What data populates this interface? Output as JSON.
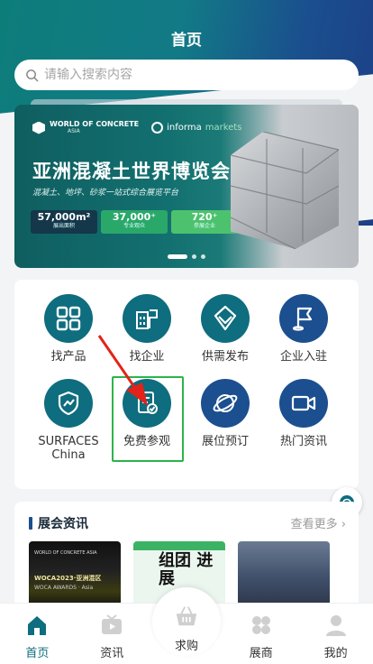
{
  "header": {
    "title": "首页"
  },
  "search": {
    "placeholder": "请输入搜索内容"
  },
  "banner": {
    "logo_woc": "WORLD OF CONCRETE",
    "logo_woc_sub": "ASIA",
    "logo_informa": "informa",
    "logo_informa_m": "markets",
    "title": "亚洲混凝土世界博览会",
    "subtitle": "混凝土、地坪、砂浆一站式综合展览平台",
    "stats": [
      {
        "value": "57,000m²",
        "label": "展出面积"
      },
      {
        "value": "37,000⁺",
        "label": "专业观众"
      },
      {
        "value": "720⁺",
        "label": "参展企业"
      }
    ],
    "dots_active_index": 0
  },
  "grid": {
    "items": [
      {
        "label": "找产品",
        "icon": "grid-four-icon"
      },
      {
        "label": "找企业",
        "icon": "building-flag-icon"
      },
      {
        "label": "供需发布",
        "icon": "diamond-icon"
      },
      {
        "label": "企业入驻",
        "icon": "flag-pin-icon"
      },
      {
        "label": "SURFACES China",
        "icon": "shield-icon"
      },
      {
        "label": "免费参观",
        "icon": "ticket-check-icon"
      },
      {
        "label": "展位预订",
        "icon": "globe-orbit-icon"
      },
      {
        "label": "热门资讯",
        "icon": "video-camera-icon"
      }
    ]
  },
  "news": {
    "title": "展会资讯",
    "more": "查看更多 ›",
    "thumb1": {
      "line1": "WORLD OF CONCRETE ASIA",
      "line2": "WOCA2023·亚洲混区",
      "line3": "WOCA AWARDS · Asia"
    },
    "thumb2": {
      "text": "组团 进展"
    }
  },
  "tabbar": {
    "tabs": [
      {
        "label": "首页"
      },
      {
        "label": "资讯"
      },
      {
        "label": "求购"
      },
      {
        "label": "展商"
      },
      {
        "label": "我的"
      }
    ],
    "active_index": 0
  },
  "colors": {
    "teal": "#0e6d7e",
    "navy": "#1b4f8f",
    "highlight": "#2db34a",
    "arrow": "#e2231a"
  }
}
